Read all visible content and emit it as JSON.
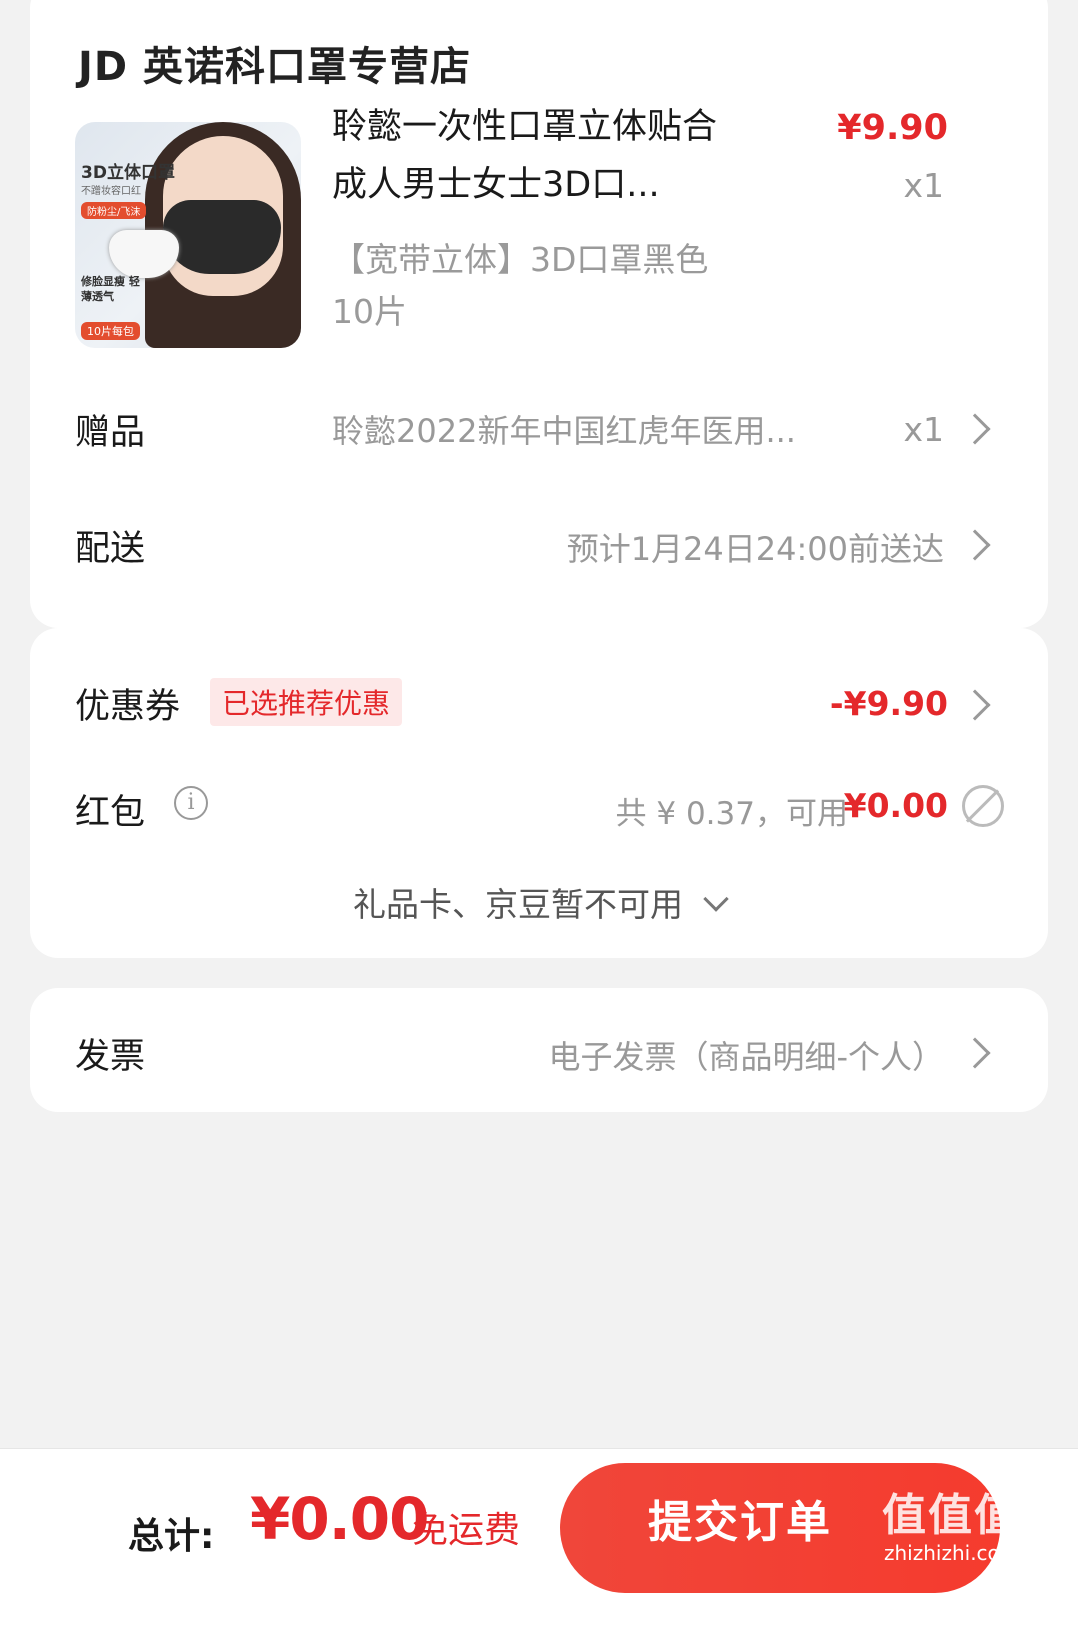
{
  "store": {
    "name": "JD 英诺科口罩专营店"
  },
  "product": {
    "thumb": {
      "t1": "3D立体口罩",
      "t2": "不蹭妆容口红",
      "t3": "防粉尘/飞沫",
      "t4": "修脸显瘦 轻薄透气",
      "t5": "10片每包"
    },
    "name": "聆懿一次性口罩立体贴合 成人男士女士3D口...",
    "price": "¥9.90",
    "qty": "x1",
    "spec": "【宽带立体】3D口罩黑色10片"
  },
  "gift": {
    "label": "赠品",
    "value": "聆懿2022新年中国红虎年医用...",
    "qty": "x1"
  },
  "shipping": {
    "label": "配送",
    "value": "预计1月24日24:00前送达"
  },
  "coupon": {
    "label": "优惠券",
    "tag": "已选推荐优惠",
    "amount": "-¥9.90"
  },
  "redpacket": {
    "label": "红包",
    "info_icon_glyph": "i",
    "total": "共 ¥ 0.37，可用",
    "available": "¥0.00"
  },
  "giftcard": {
    "text": "礼品卡、京豆暂不可用"
  },
  "invoice": {
    "label": "发票",
    "value": "电子发票（商品明细-个人）"
  },
  "footer": {
    "total_label": "总计:",
    "total_amount": "¥0.00",
    "free_shipping": "免运费",
    "submit_label": "提交订单",
    "watermark": "值值值",
    "watermark_url": "zhizhizhi.com"
  },
  "colors": {
    "accent_red": "#e4282b",
    "button_red": "#f0463a",
    "background": "#f2f2f2"
  }
}
